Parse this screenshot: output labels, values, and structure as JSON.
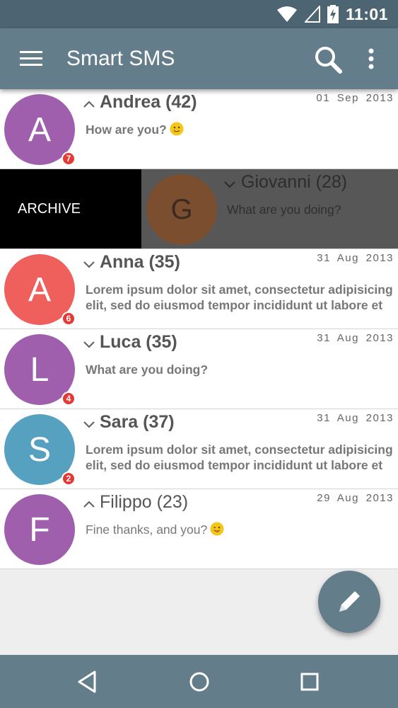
{
  "status": {
    "time": "11:01"
  },
  "appbar": {
    "title": "Smart SMS"
  },
  "archive_label": "ARCHIVE",
  "conversations": [
    {
      "initial": "A",
      "name": "Andrea (42)",
      "date": "01 Sep 2013",
      "preview": "How are you?",
      "badge": "7",
      "color": "#a05fad"
    },
    {
      "initial": "G",
      "name": "Giovanni (28)",
      "date": "",
      "preview": "What are you doing?",
      "badge": "",
      "color": "#7a4e2e"
    },
    {
      "initial": "A",
      "name": "Anna (35)",
      "date": "31 Aug 2013",
      "preview": "Lorem ipsum dolor sit amet, consectetur adipisicing elit, sed do eiusmod tempor incididunt ut labore et",
      "badge": "6",
      "color": "#ef5f5b"
    },
    {
      "initial": "L",
      "name": "Luca (35)",
      "date": "31 Aug 2013",
      "preview": "What are you doing?",
      "badge": "4",
      "color": "#a05fad"
    },
    {
      "initial": "S",
      "name": "Sara (37)",
      "date": "31 Aug 2013",
      "preview": "Lorem ipsum dolor sit amet, consectetur adipisicing elit, sed do eiusmod tempor incididunt ut labore et",
      "badge": "2",
      "color": "#56a0c0"
    },
    {
      "initial": "F",
      "name": "Filippo (23)",
      "date": "29 Aug 2013",
      "preview": "Fine thanks, and you?",
      "badge": "",
      "color": "#a05fad"
    }
  ],
  "icons": {
    "wifi": "wifi-icon",
    "signal": "signal-icon",
    "battery": "battery-charging-icon",
    "menu": "hamburger-menu-icon",
    "search": "search-icon",
    "more": "more-vertical-icon",
    "compose": "pencil-icon",
    "back": "back-icon",
    "home": "home-icon",
    "recents": "recents-icon"
  },
  "colors": {
    "primary": "#637d8a",
    "status_bar": "#4d6472",
    "badge": "#e53935"
  }
}
